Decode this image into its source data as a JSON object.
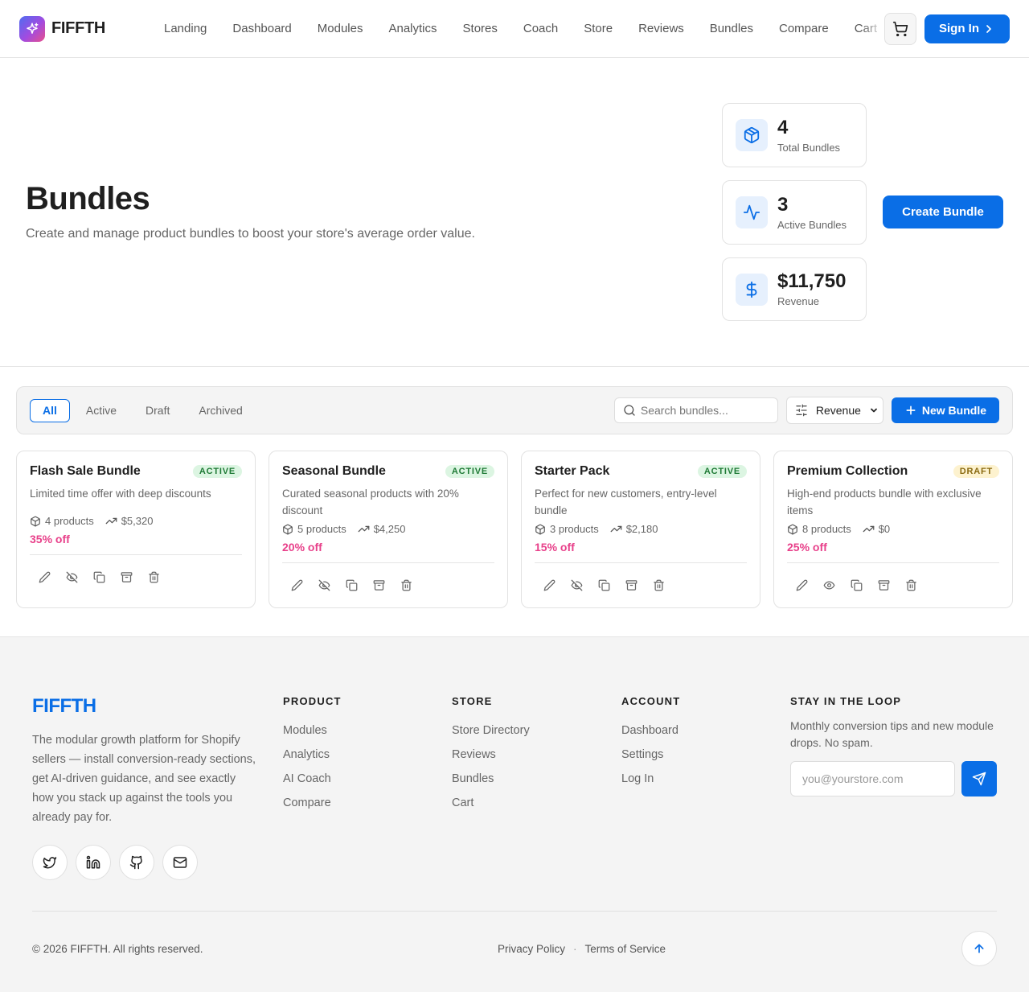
{
  "header": {
    "brand": "FIFFTH",
    "nav": [
      "Landing",
      "Dashboard",
      "Modules",
      "Analytics",
      "Stores",
      "Coach",
      "Store",
      "Reviews",
      "Bundles",
      "Compare",
      "Cart"
    ],
    "sign_in_label": "Sign In"
  },
  "hero": {
    "title": "Bundles",
    "subtitle": "Create and manage product bundles to boost your store's average order value.",
    "stats": [
      {
        "value": "4",
        "label": "Total Bundles",
        "icon": "box-icon"
      },
      {
        "value": "3",
        "label": "Active Bundles",
        "icon": "activity-icon"
      },
      {
        "value": "$11,750",
        "label": "Revenue",
        "icon": "dollar-icon"
      }
    ],
    "create_label": "Create Bundle"
  },
  "toolbar": {
    "tabs": [
      "All",
      "Active",
      "Draft",
      "Archived"
    ],
    "active_tab": "All",
    "search_placeholder": "Search bundles...",
    "sort_value": "Revenue",
    "new_label": "New Bundle"
  },
  "bundles": [
    {
      "title": "Flash Sale Bundle",
      "status": "ACTIVE",
      "description": "Limited time offer with deep discounts",
      "products": "4 products",
      "revenue": "$5,320",
      "discount": "35% off"
    },
    {
      "title": "Seasonal Bundle",
      "status": "ACTIVE",
      "description": "Curated seasonal products with 20% discount",
      "products": "5 products",
      "revenue": "$4,250",
      "discount": "20% off"
    },
    {
      "title": "Starter Pack",
      "status": "ACTIVE",
      "description": "Perfect for new customers, entry-level bundle",
      "products": "3 products",
      "revenue": "$2,180",
      "discount": "15% off"
    },
    {
      "title": "Premium Collection",
      "status": "DRAFT",
      "description": "High-end products bundle with exclusive items",
      "products": "8 products",
      "revenue": "$0",
      "discount": "25% off"
    }
  ],
  "footer": {
    "brand": "FIFFTH",
    "about": "The modular growth platform for Shopify sellers — install conversion-ready sections, get AI-driven guidance, and see exactly how you stack up against the tools you already pay for.",
    "columns": [
      {
        "heading": "PRODUCT",
        "links": [
          "Modules",
          "Analytics",
          "AI Coach",
          "Compare"
        ]
      },
      {
        "heading": "STORE",
        "links": [
          "Store Directory",
          "Reviews",
          "Bundles",
          "Cart"
        ]
      },
      {
        "heading": "ACCOUNT",
        "links": [
          "Dashboard",
          "Settings",
          "Log In"
        ]
      }
    ],
    "newsletter": {
      "heading": "STAY IN THE LOOP",
      "text": "Monthly conversion tips and new module drops. No spam.",
      "placeholder": "you@yourstore.com"
    },
    "copyright": "© 2026 FIFFTH. All rights reserved.",
    "legal": [
      "Privacy Policy",
      "Terms of Service"
    ],
    "separator": "·"
  },
  "colors": {
    "accent": "#0a6ee6",
    "discount": "#e8408a",
    "active_badge": "#1e7a35",
    "draft_badge": "#8a6a10"
  }
}
